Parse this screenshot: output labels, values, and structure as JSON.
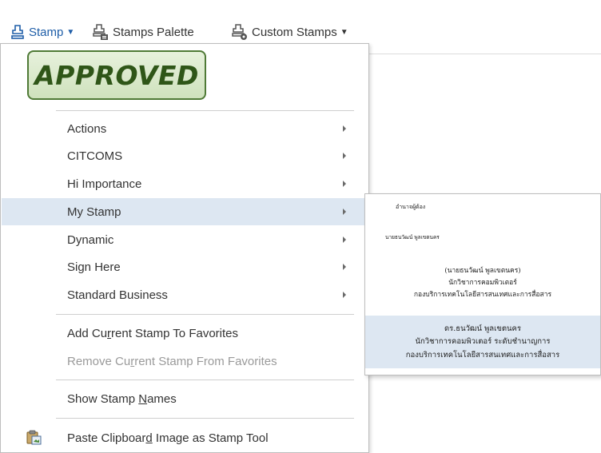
{
  "toolbar": {
    "stamp_label": "Stamp",
    "palette_label": "Stamps Palette",
    "custom_label": "Custom Stamps"
  },
  "menu": {
    "approved_stamp": "APPROVED",
    "items": [
      {
        "label": "Actions",
        "submenu": true
      },
      {
        "label": "CITCOMS",
        "submenu": true
      },
      {
        "label": "Hi Importance",
        "submenu": true
      },
      {
        "label": "My Stamp",
        "submenu": true,
        "highlighted": true
      },
      {
        "label": "Dynamic",
        "submenu": true
      },
      {
        "label": "Sign Here",
        "submenu": true
      },
      {
        "label": "Standard Business",
        "submenu": true
      }
    ],
    "add_favorites": {
      "pre": "Add Cu",
      "u": "r",
      "post": "rent Stamp To Favorites"
    },
    "remove_favorites": {
      "pre": "Remove Cu",
      "u": "r",
      "post": "rent Stamp From Favorites",
      "disabled": true
    },
    "show_names": {
      "pre": "Show Stamp ",
      "u": "N",
      "post": "ames"
    },
    "paste_clipboard": {
      "pre": "Paste Clipboar",
      "u": "d",
      "post": " Image as Stamp Tool"
    }
  },
  "submenu": {
    "stamp1": "อำนาจผู้ต้อง",
    "stamp2": "นายธนวัฒน์ พูลเขตนคร",
    "stamp3": [
      "(นายธนวัฒน์ พูลเขตนคร)",
      "นักวิชาการคอมพิวเตอร์",
      "กองบริการเทคโนโลยีสารสนเทศและการสื่อสาร"
    ],
    "stamp4": [
      "ดร.ธนวัฒน์ พูลเขตนคร",
      "นักวิชาการคอมพิวเตอร์ ระดับชำนาญการ",
      "กองบริการเทคโนโลยีสารสนเทศและการสื่อสาร"
    ]
  },
  "colors": {
    "accent": "#1f5ea8",
    "highlight": "#dde7f2",
    "approved_border": "#4f7a36",
    "approved_text": "#2f5618"
  }
}
